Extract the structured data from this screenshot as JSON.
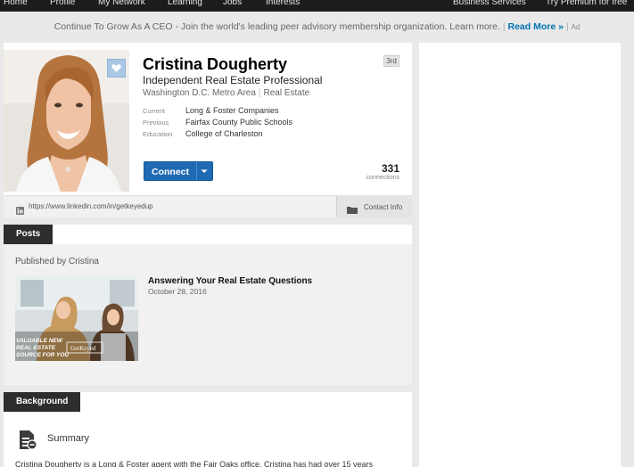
{
  "nav": {
    "items": [
      "Home",
      "Profile",
      "My Network",
      "Learning",
      "Jobs",
      "Interests"
    ],
    "business_services": "Business Services",
    "premium": "Try Premium for free"
  },
  "ad_banner": {
    "text": "Continue To Grow As A CEO - Join the world's leading peer advisory membership organization. Learn more.",
    "separator": "|",
    "read_more": "Read More »",
    "ad_label": "Ad"
  },
  "profile": {
    "name": "Cristina Dougherty",
    "degree": "3rd",
    "headline": "Independent Real Estate Professional",
    "location": "Washington D.C. Metro Area",
    "industry": "Real Estate",
    "current_label": "Current",
    "current_value": "Long & Foster Companies",
    "previous_label": "Previous",
    "previous_value": "Fairfax County Public Schools",
    "education_label": "Education",
    "education_value": "College of Charleston",
    "connect_label": "Connect",
    "connections_count": "331",
    "connections_label": "connections",
    "url": "https://www.linkedin.com/in/getkeyedup",
    "contact_info_label": "Contact Info"
  },
  "posts": {
    "tab_label": "Posts",
    "published_by": "Published by Cristina",
    "post_title": "Answering Your Real Estate Questions",
    "post_date": "October 28, 2016",
    "thumb_caption_lines": [
      "VALUABLE NEW",
      "REAL ESTATE",
      "SOURCE FOR YOU"
    ],
    "thumb_logo": "GetKeyed"
  },
  "background": {
    "tab_label": "Background",
    "summary_title": "Summary",
    "summary_text": "Cristina Dougherty is a Long & Foster agent with the Fair Oaks office. Cristina has had over 15 years"
  },
  "colors": {
    "accent": "#0073b1",
    "connect_button": "#1f6ab2",
    "nav_bg": "#1c1c1c",
    "section_tab_bg": "#2d2d2d"
  }
}
